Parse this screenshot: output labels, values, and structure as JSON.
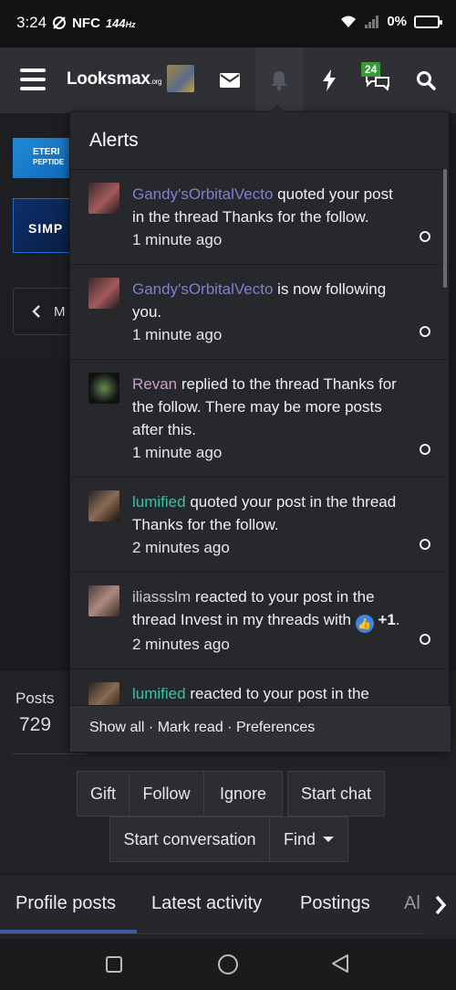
{
  "status_bar": {
    "time": "3:24",
    "nfc": "NFC",
    "refresh": "144",
    "refresh_unit": "Hz",
    "battery": "0%"
  },
  "nav": {
    "logo": "Looksmax",
    "logo_suffix": ".org",
    "notification_badge": "24"
  },
  "banners": {
    "banner1_text": "ETERI",
    "banner1_sub": "PEPTIDE",
    "banner2_text": "SIMP"
  },
  "back_button": {
    "label": "M"
  },
  "alerts": {
    "title": "Alerts",
    "items": [
      {
        "user": "Gandy'sOrbitalVecto",
        "text": " quoted your post in the thread Thanks for the follow.",
        "time": "1 minute ago"
      },
      {
        "user": "Gandy'sOrbitalVecto",
        "text": " is now following you.",
        "time": "1 minute ago"
      },
      {
        "user": "Revan",
        "text": " replied to the thread Thanks for the follow. There may be more posts after this.",
        "time": "1 minute ago"
      },
      {
        "user": "lumified",
        "text": " quoted your post in the thread Thanks for the follow.",
        "time": "2 minutes ago"
      },
      {
        "user": "iliassslm",
        "text": " reacted to your post in the thread Invest in my threads with ",
        "reaction": "+1",
        "text_end": ".",
        "time": "2 minutes ago"
      },
      {
        "user": "lumified",
        "text": " reacted to your post in the thread Thanks for the follow with",
        "time": ""
      }
    ],
    "footer": {
      "show_all": "Show all",
      "sep1": " · ",
      "mark_read": "Mark read",
      "sep2": " · ",
      "preferences": "Preferences"
    }
  },
  "profile": {
    "posts_label": "Posts",
    "posts_value": "729",
    "buttons": {
      "gift": "Gift",
      "follow": "Follow",
      "ignore": "Ignore",
      "start_chat": "Start chat",
      "start_conversation": "Start conversation",
      "find": "Find"
    }
  },
  "tabs": {
    "profile_posts": "Profile posts",
    "latest_activity": "Latest activity",
    "postings": "Postings",
    "about": "Al"
  },
  "colors": {
    "accent": "#3b5aa8",
    "user_purple": "#7d7fd6",
    "user_teal": "#3fbfa8",
    "badge_green": "#3a9a3a"
  }
}
